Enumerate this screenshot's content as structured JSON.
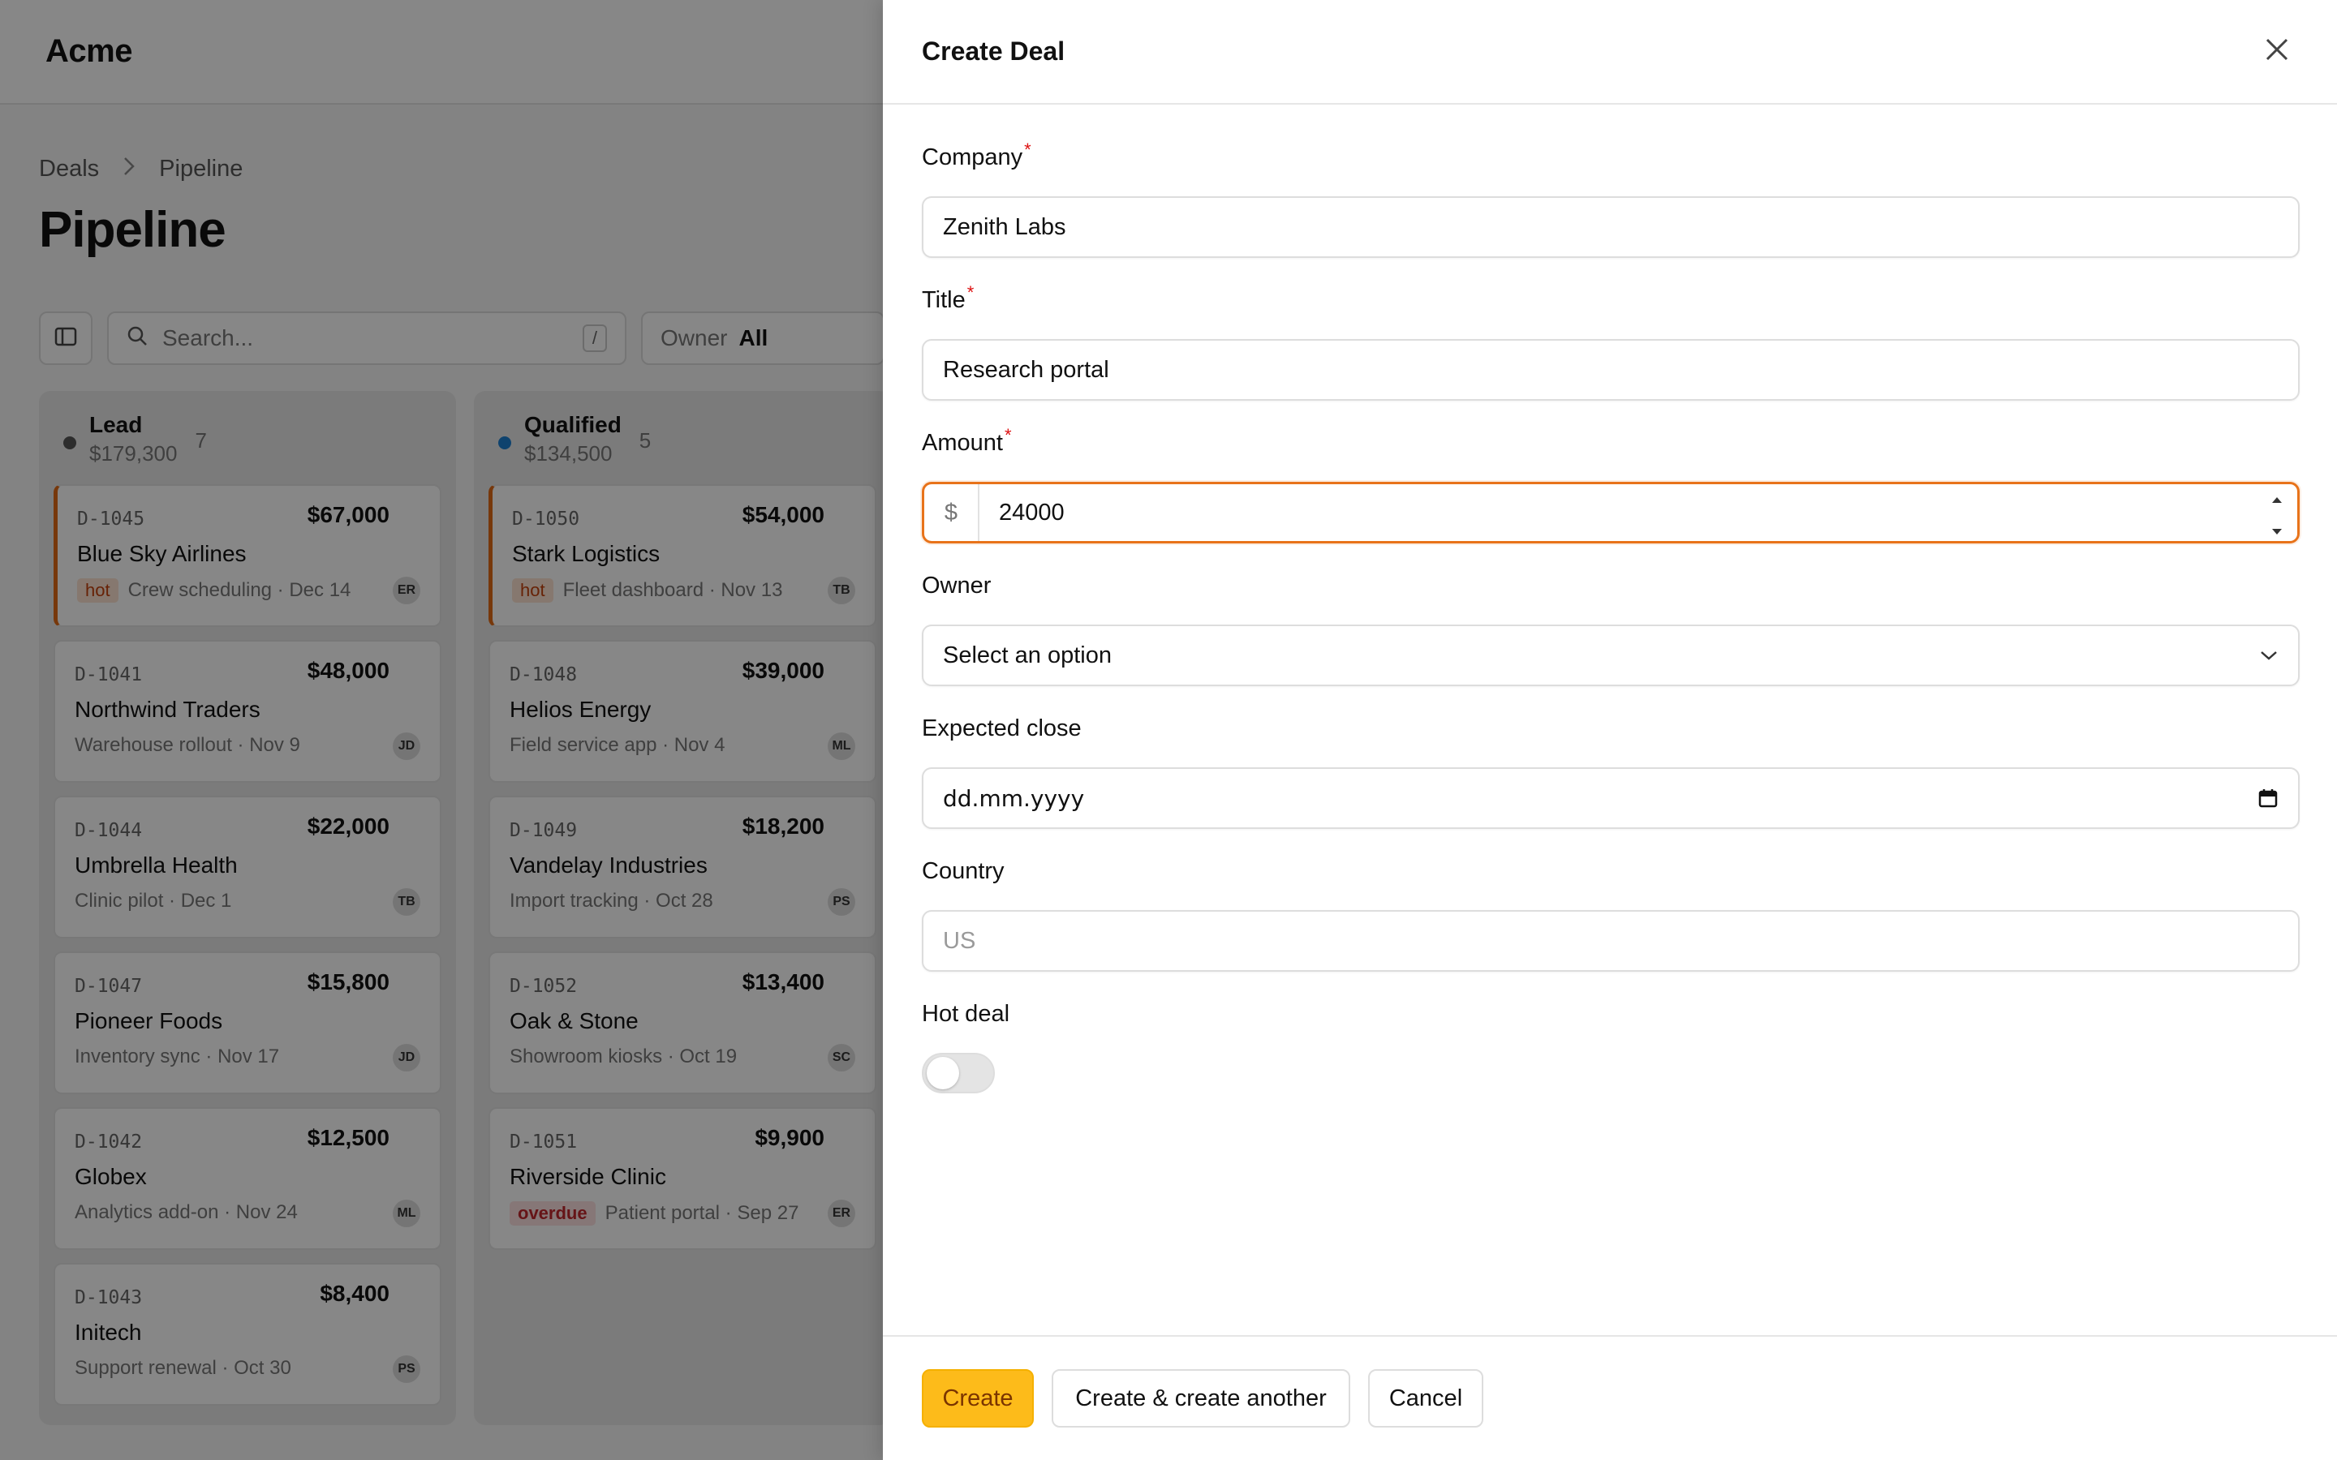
{
  "app": {
    "logo": "Acme",
    "breadcrumb": [
      "Deals",
      "Pipeline"
    ],
    "page_title": "Pipeline",
    "search_placeholder": "Search...",
    "search_shortcut": "/",
    "owner_filter_label": "Owner",
    "owner_filter_value": "All"
  },
  "columns": [
    {
      "name": "Lead",
      "total": "$179,300",
      "count": "7",
      "color": "#555555",
      "cards": [
        {
          "id": "D-1045",
          "amount": "$67,000",
          "company": "Blue Sky Airlines",
          "tag": "hot",
          "meta": "Crew scheduling · Dec 14",
          "owner": "ER"
        },
        {
          "id": "D-1041",
          "amount": "$48,000",
          "company": "Northwind Traders",
          "tag": "",
          "meta": "Warehouse rollout · Nov 9",
          "owner": "JD"
        },
        {
          "id": "D-1044",
          "amount": "$22,000",
          "company": "Umbrella Health",
          "tag": "",
          "meta": "Clinic pilot · Dec 1",
          "owner": "TB"
        },
        {
          "id": "D-1047",
          "amount": "$15,800",
          "company": "Pioneer Foods",
          "tag": "",
          "meta": "Inventory sync · Nov 17",
          "owner": "JD"
        },
        {
          "id": "D-1042",
          "amount": "$12,500",
          "company": "Globex",
          "tag": "",
          "meta": "Analytics add-on · Nov 24",
          "owner": "ML"
        },
        {
          "id": "D-1043",
          "amount": "$8,400",
          "company": "Initech",
          "tag": "",
          "meta": "Support renewal · Oct 30",
          "owner": "PS"
        }
      ]
    },
    {
      "name": "Qualified",
      "total": "$134,500",
      "count": "5",
      "color": "#1d7fd0",
      "cards": [
        {
          "id": "D-1050",
          "amount": "$54,000",
          "company": "Stark Logistics",
          "tag": "hot",
          "meta": "Fleet dashboard · Nov 13",
          "owner": "TB"
        },
        {
          "id": "D-1048",
          "amount": "$39,000",
          "company": "Helios Energy",
          "tag": "",
          "meta": "Field service app · Nov 4",
          "owner": "ML"
        },
        {
          "id": "D-1049",
          "amount": "$18,200",
          "company": "Vandelay Industries",
          "tag": "",
          "meta": "Import tracking · Oct 28",
          "owner": "PS"
        },
        {
          "id": "D-1052",
          "amount": "$13,400",
          "company": "Oak & Stone",
          "tag": "",
          "meta": "Showroom kiosks · Oct 19",
          "owner": "SC"
        },
        {
          "id": "D-1051",
          "amount": "$9,900",
          "company": "Riverside Clinic",
          "tag": "overdue",
          "meta": "Patient portal · Sep 27",
          "owner": "ER"
        }
      ]
    }
  ],
  "drawer": {
    "title": "Create Deal",
    "fields": {
      "company": {
        "label": "Company",
        "value": "Zenith Labs"
      },
      "title": {
        "label": "Title",
        "value": "Research portal"
      },
      "amount": {
        "label": "Amount",
        "prefix": "$",
        "value": "24000"
      },
      "owner": {
        "label": "Owner",
        "value": "Select an option"
      },
      "expected_close": {
        "label": "Expected close",
        "value": "dd.mm.yyyy"
      },
      "country": {
        "label": "Country",
        "placeholder": "US"
      },
      "hot_deal": {
        "label": "Hot deal",
        "checked": false
      }
    },
    "required_mark": "*",
    "buttons": {
      "create": "Create",
      "create_another": "Create & create another",
      "cancel": "Cancel"
    }
  },
  "colors": {
    "accent": "#e8731a",
    "primary_button": "#fdbb1a",
    "hot_border": "#e06a16"
  }
}
